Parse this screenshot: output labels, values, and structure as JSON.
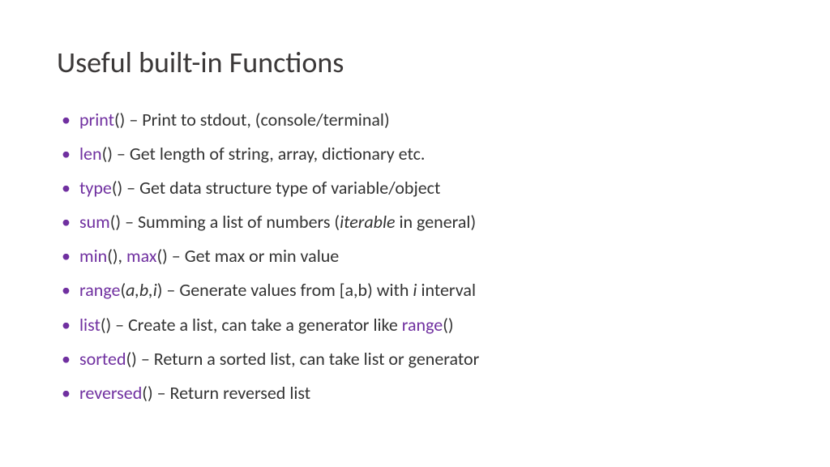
{
  "title": "Useful built-in Functions",
  "items": [
    {
      "fn": "print",
      "args": "()",
      "sep": " – ",
      "desc_pre": "Print to stdout, (console/terminal)",
      "italic": "",
      "desc_post": ""
    },
    {
      "fn": "len",
      "args": "()",
      "sep": " – ",
      "desc_pre": "Get length of string, array, dictionary etc.",
      "italic": "",
      "desc_post": ""
    },
    {
      "fn": "type",
      "args": "()",
      "sep": " – ",
      "desc_pre": "Get data structure type of variable/object",
      "italic": "",
      "desc_post": ""
    },
    {
      "fn": "sum",
      "args": "()",
      "sep": " – ",
      "desc_pre": "Summing a list of numbers (",
      "italic": "iterable",
      "desc_post": " in general)"
    },
    {
      "fn": "min",
      "args": "(), ",
      "fn2": "max",
      "args2": "()",
      "sep": " – ",
      "desc_pre": "Get max or min value",
      "italic": "",
      "desc_post": ""
    },
    {
      "fn": "range",
      "args_open": "(",
      "args_italic": "a,b,i",
      "args_close": ")",
      "sep": " – ",
      "desc_pre": "Generate values from [a,b) with ",
      "italic": "i",
      "desc_post": " interval"
    },
    {
      "fn": "list",
      "args": "()",
      "sep": " – ",
      "desc_pre": "Create a list, can take a generator like ",
      "fn_inline": "range",
      "desc_post2": "()"
    },
    {
      "fn": "sorted",
      "args": "()",
      "sep": " – ",
      "desc_pre": "Return a sorted list, can take list or generator",
      "italic": "",
      "desc_post": ""
    },
    {
      "fn": "reversed",
      "args": "()",
      "sep": " – ",
      "desc_pre": "Return reversed list",
      "italic": "",
      "desc_post": ""
    }
  ]
}
